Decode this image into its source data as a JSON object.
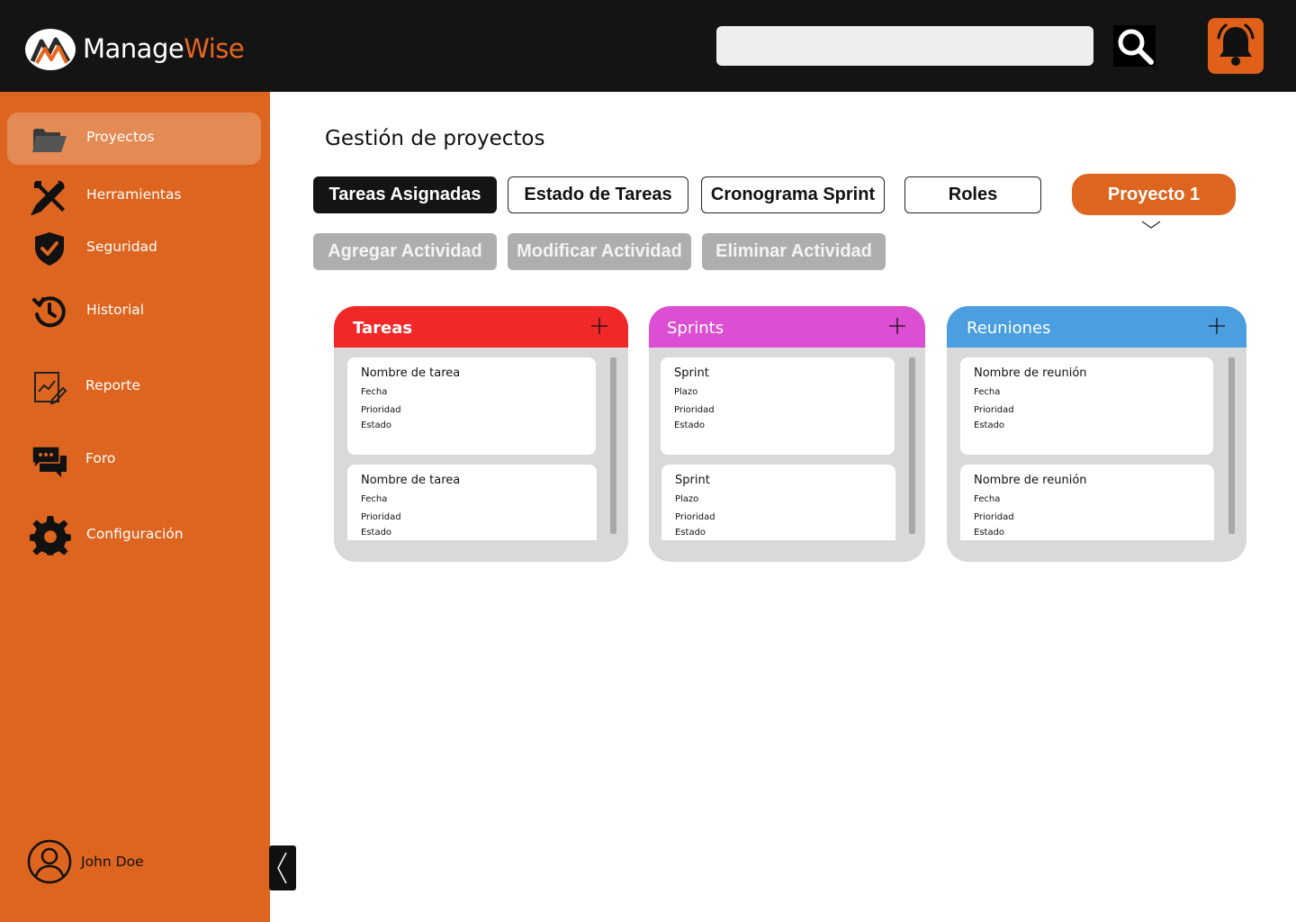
{
  "app": {
    "brand_primary": "Manage",
    "brand_accent": "Wise",
    "logo_icon": "managewise-logo-icon"
  },
  "colors": {
    "topbar": "#141414",
    "accent": "#dd651f",
    "active_nav": "#e38a55",
    "tareas": "#f02828",
    "sprints": "#dd4fd2",
    "reuniones": "#4b9ee0",
    "board_bg": "#d9d9d9",
    "disabled_action": "#aeaeae"
  },
  "header": {
    "search_placeholder": "",
    "search_icon": "search-icon",
    "notifications_icon": "bell-icon"
  },
  "sidebar": {
    "items": [
      {
        "label": "Proyectos",
        "icon": "folder-icon",
        "active": true
      },
      {
        "label": "Herramientas",
        "icon": "tools-icon"
      },
      {
        "label": "Seguridad",
        "icon": "shield-icon"
      },
      {
        "label": "Historial",
        "icon": "history-icon"
      },
      {
        "label": "Reporte",
        "icon": "report-icon"
      },
      {
        "label": "Foro",
        "icon": "chat-icon"
      },
      {
        "label": "Configuración",
        "icon": "gear-icon"
      }
    ],
    "user": {
      "name": "John Doe",
      "icon": "user-avatar-icon"
    },
    "collapse_icon": "chevron-left-icon"
  },
  "main": {
    "title": "Gestión de proyectos",
    "tabs": [
      {
        "label": "Tareas Asignadas",
        "active": true
      },
      {
        "label": "Estado de Tareas"
      },
      {
        "label": "Cronograma Sprint"
      },
      {
        "label": "Roles"
      }
    ],
    "project_selector": {
      "value": "Proyecto 1",
      "icon": "chevron-down-icon"
    },
    "actions": [
      {
        "label": "Agregar Actividad"
      },
      {
        "label": "Modificar Actividad"
      },
      {
        "label": "Eliminar Actividad"
      }
    ],
    "boards": [
      {
        "title": "Tareas",
        "add_icon": "plus-icon",
        "cards": [
          {
            "title": "Nombre de tarea",
            "f1": "Fecha",
            "f2": "Prioridad",
            "f3": "Estado"
          },
          {
            "title": "Nombre de tarea",
            "f1": "Fecha",
            "f2": "Prioridad",
            "f3": "Estado"
          }
        ]
      },
      {
        "title": "Sprints",
        "add_icon": "plus-icon",
        "cards": [
          {
            "title": "Sprint",
            "f1": "Plazo",
            "f2": "Prioridad",
            "f3": "Estado"
          },
          {
            "title": "Sprint",
            "f1": "Plazo",
            "f2": "Prioridad",
            "f3": "Estado"
          }
        ]
      },
      {
        "title": "Reuniones",
        "add_icon": "plus-icon",
        "cards": [
          {
            "title": "Nombre de reunión",
            "f1": "Fecha",
            "f2": "Prioridad",
            "f3": "Estado"
          },
          {
            "title": "Nombre de reunión",
            "f1": "Fecha",
            "f2": "Prioridad",
            "f3": "Estado"
          }
        ]
      }
    ]
  }
}
